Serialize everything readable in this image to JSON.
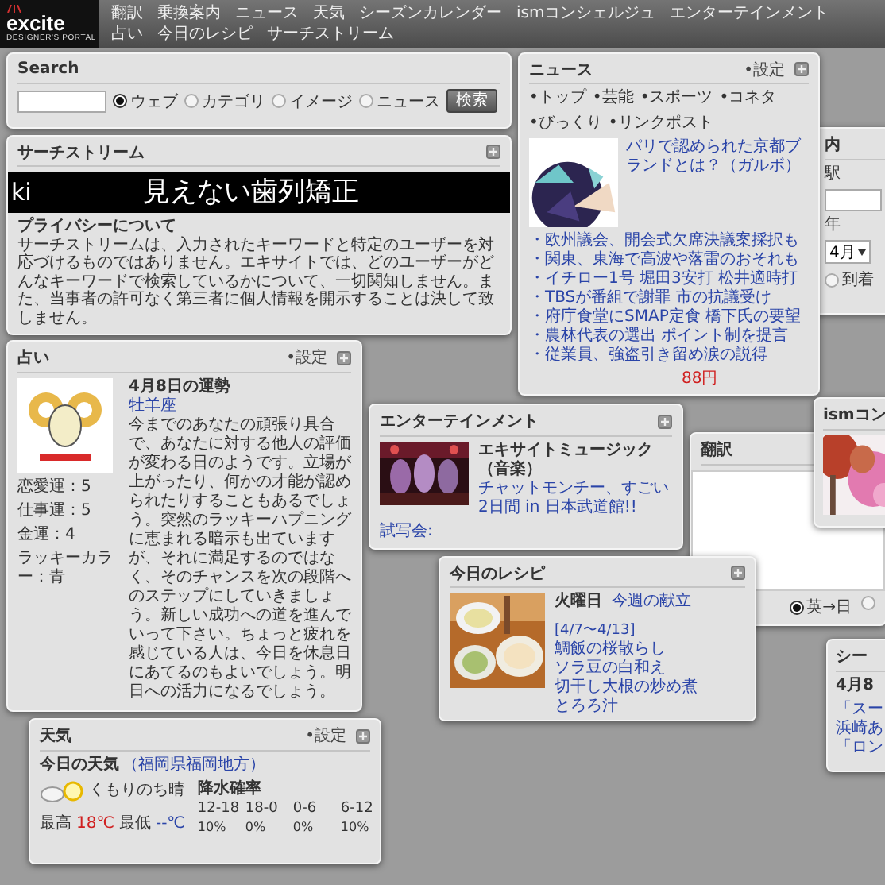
{
  "header": {
    "logo": {
      "name": "excite",
      "tagline": "DESIGNER'S PORTAL"
    },
    "nav": [
      "翻訳",
      "乗換案内",
      "ニュース",
      "天気",
      "シーズンカレンダー",
      "ismコンシェルジュ",
      "エンターテインメント",
      "占い",
      "今日のレシピ",
      "サーチストリーム"
    ]
  },
  "search": {
    "title": "Search",
    "options": [
      {
        "label": "ウェブ",
        "selected": true
      },
      {
        "label": "カテゴリ",
        "selected": false
      },
      {
        "label": "イメージ",
        "selected": false
      },
      {
        "label": "ニュース",
        "selected": false
      }
    ],
    "button": "検索"
  },
  "searchstream": {
    "title": "サーチストリーム",
    "banner_left": "ki",
    "banner": "見えない歯列矯正",
    "privacy_title": "プライバシーについて",
    "privacy_text": "サーチストリームは、入力されたキーワードと特定のユーザーを対応づけるものではありません。エキサイトでは、どのユーザーがどんなキーワードで検索しているかについて、一切関知しません。また、当事者の許可なく第三者に個人情報を開示することは決して致しません。"
  },
  "transit": {
    "title": "内",
    "station": "駅",
    "year": "年",
    "month": "4月",
    "options": [
      {
        "label": "到着",
        "selected": false
      }
    ]
  },
  "news": {
    "title": "ニュース",
    "settings": "•設定",
    "nav": [
      "•トップ",
      "•芸能",
      "•スポーツ",
      "•コネタ",
      "•びっくり",
      "•リンクポスト"
    ],
    "headline": "パリで認められた京都ブランドとは？（ガルボ）",
    "links": [
      "・欧州議会、開会式欠席決議案採択も",
      "・関東、東海で高波や落雷のおそれも",
      "・イチロー1号 堀田3安打 松井適時打",
      "・TBSが番組で謝罪 市の抗議受け",
      "・府庁食堂にSMAP定食 橋下氏の要望",
      "・農林代表の選出 ポイント制を提言",
      "・従業員、強盗引き留め涙の説得"
    ],
    "price": "88円"
  },
  "ism": {
    "title": "ismコン"
  },
  "translation": {
    "title": "翻訳",
    "options": [
      {
        "label": "英→日",
        "selected": true
      },
      {
        "selected": false
      }
    ]
  },
  "season": {
    "title": "シー",
    "date": "4月8",
    "links": [
      "「スー",
      "浜崎あ",
      "「ロン"
    ]
  },
  "fortune": {
    "title": "占い",
    "settings": "•設定",
    "date": "4月8日の運勢",
    "sign": "牡羊座",
    "text": "今までのあなたの頑張り具合で、あなたに対する他人の評価が変わる日のようです。立場が上がったり、何かの才能が認められたりすることもあるでしょう。突然のラッキーハプニングに恵まれる暗示も出ていますが、それに満足するのではなく、そのチャンスを次の段階へのステップにしていきましょう。新しい成功への道を進んでいって下さい。ちょっと疲れを感じている人は、今日を休息日にあてるのもよいでしょう。明日への活力になるでしょう。",
    "stats": [
      {
        "label": "恋愛運：",
        "value": "5"
      },
      {
        "label": "仕事運：",
        "value": "5"
      },
      {
        "label": "金運：",
        "value": "4"
      },
      {
        "label": "ラッキーカラー：",
        "value": "青"
      }
    ]
  },
  "weather": {
    "title": "天気",
    "settings": "•設定",
    "heading": "今日の天気",
    "region": "（福岡県福岡地方）",
    "condition": "くもりのち晴",
    "rain_title": "降水確率",
    "periods": [
      "12-18",
      "18-0",
      "0-6",
      "6-12"
    ],
    "rain": [
      "10%",
      "0%",
      "0%",
      "10%"
    ],
    "high_label": "最高",
    "high": "18℃",
    "low_label": "最低",
    "low": "--℃"
  },
  "entertainment": {
    "title": "エンターテインメント",
    "heading": "エキサイトミュージック（音楽）",
    "link": "チャットモンチー、すごい2日間 in 日本武道館!!",
    "footer": "試写会:"
  },
  "recipe": {
    "title": "今日のレシピ",
    "day": "火曜日",
    "menu_link": "今週の献立",
    "range": "[4/7〜4/13]",
    "links": [
      "鯛飯の桜散らし",
      "ソラ豆の白和え",
      "切干し大根の炒め煮",
      "とろろ汁"
    ]
  }
}
